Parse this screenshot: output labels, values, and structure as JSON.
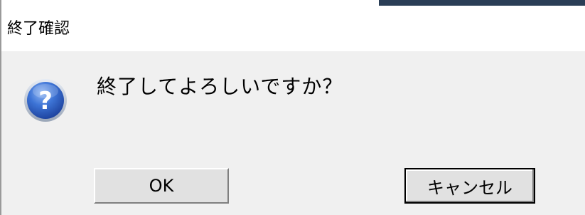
{
  "dialog": {
    "title": "終了確認",
    "message": "終了してよろしいですか？",
    "icon": "question-icon"
  },
  "buttons": {
    "ok_label": "OK",
    "cancel_label": "キャンセル"
  },
  "colors": {
    "icon_blue": "#2b61c8",
    "title_accent": "#2a3e56"
  }
}
